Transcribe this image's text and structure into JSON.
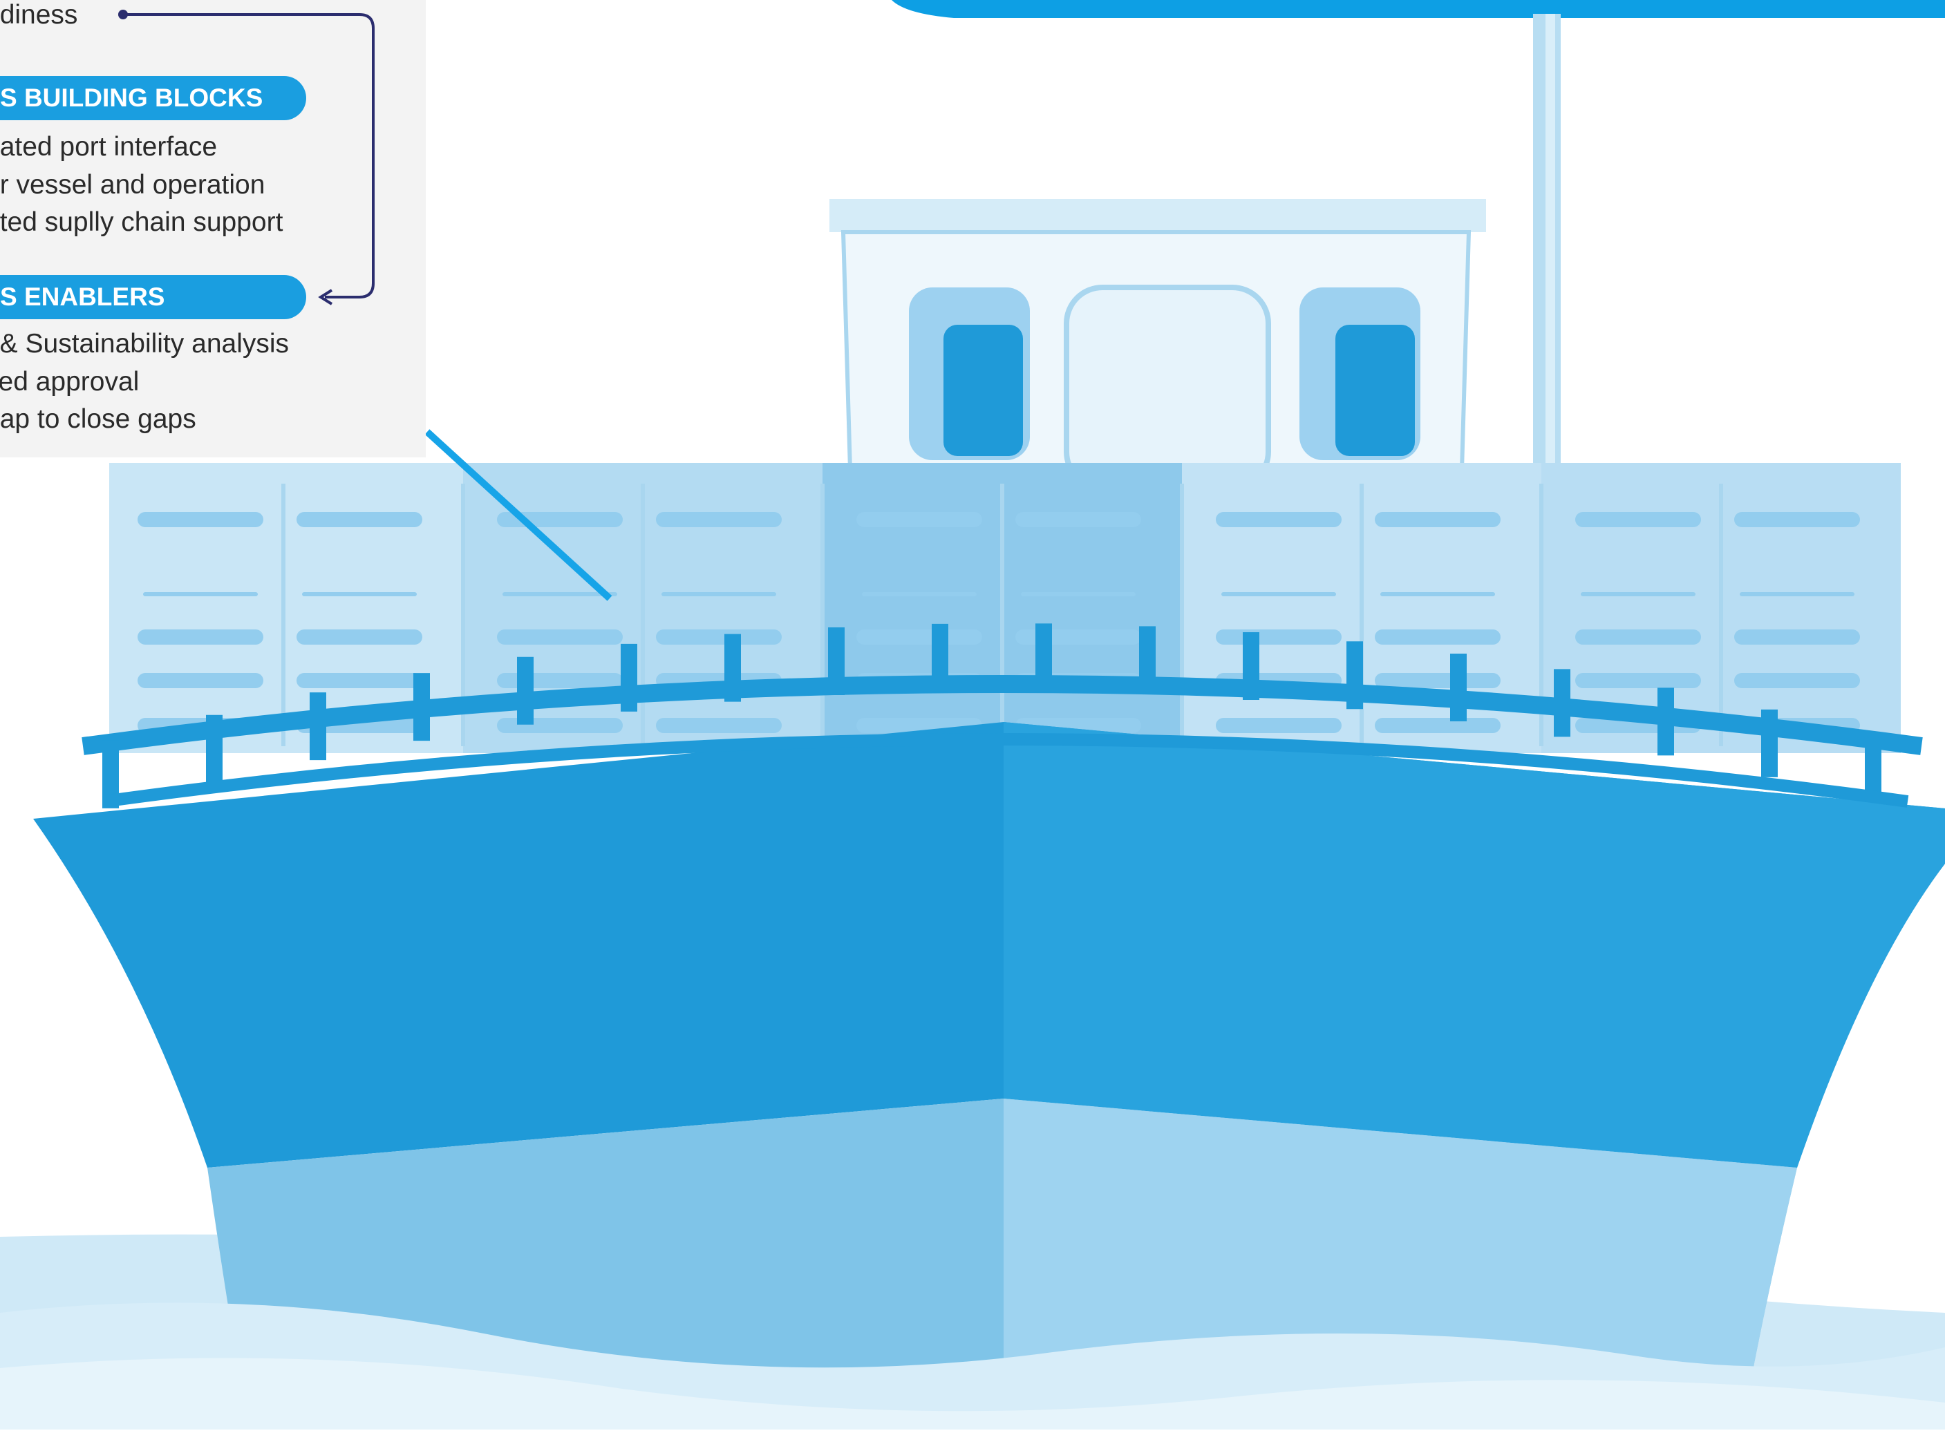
{
  "panel": {
    "readiness_text": "adiness",
    "building_blocks": {
      "header": "S BUILDING BLOCKS",
      "items": [
        "nated port interface",
        "ar vessel and operation",
        "ated suplly chain support"
      ]
    },
    "enablers": {
      "header": "S ENABLERS",
      "items": [
        "t & Sustainability analysis",
        "fied approval",
        "nap to close gaps"
      ]
    }
  },
  "colors": {
    "primary_blue": "#1a9ee0",
    "light_blue": "#7fc4e8",
    "pale_blue": "#c9e6f6",
    "navy_connector": "#2b2d6e",
    "panel_bg": "#f3f3f3"
  }
}
